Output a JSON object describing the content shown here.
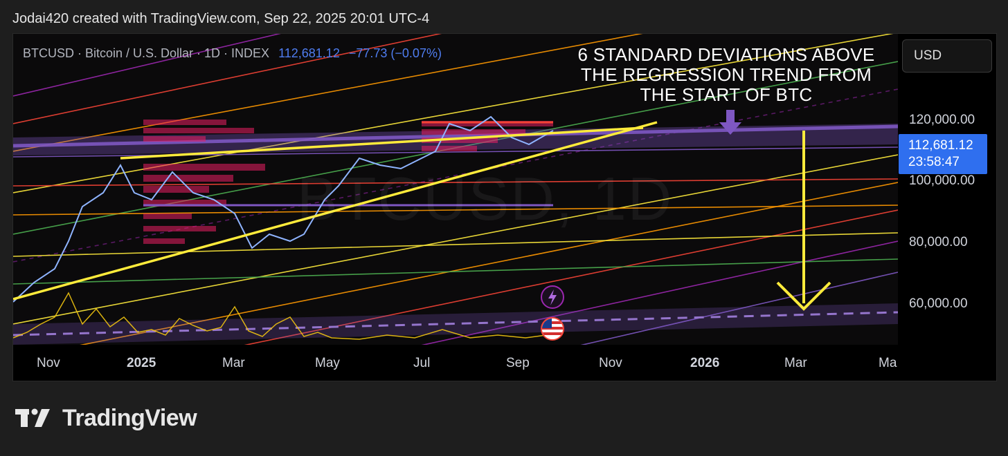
{
  "header": {
    "attribution": "Jodai420 created with TradingView.com, Sep 22, 2025 20:01 UTC-4"
  },
  "legend": {
    "symbol_text": "BTCUSD · Bitcoin / U.S. Dollar · 1D · INDEX",
    "price": "112,681.12",
    "change": "−77.73 (−0.07%)"
  },
  "annotation": {
    "lines": [
      "6 STANDARD DEVIATIONS ABOVE",
      "THE REGRESSION TREND FROM",
      "THE START OF BTC"
    ]
  },
  "watermark": "BTCUSD, 1D",
  "currency_button": "USD",
  "y_axis": {
    "ticks": [
      "120,000.00",
      "100,000.00",
      "80,000.00",
      "60,000.00"
    ]
  },
  "price_tag": {
    "price": "112,681.12",
    "countdown": "23:58:47"
  },
  "x_axis": {
    "ticks": [
      {
        "label": "Nov",
        "bold": false
      },
      {
        "label": "2025",
        "bold": true
      },
      {
        "label": "Mar",
        "bold": false
      },
      {
        "label": "May",
        "bold": false
      },
      {
        "label": "Jul",
        "bold": false
      },
      {
        "label": "Sep",
        "bold": false
      },
      {
        "label": "Nov",
        "bold": false
      },
      {
        "label": "2026",
        "bold": true
      },
      {
        "label": "Mar",
        "bold": false
      },
      {
        "label": "Ma",
        "bold": false
      }
    ]
  },
  "events": {
    "lightning_icon": "lightning-icon",
    "flag_icon": "us-flag-icon"
  },
  "brand": {
    "name": "TradingView"
  },
  "colors": {
    "accent_blue": "#2f6fef",
    "trend_yellow": "#ffeb3b",
    "band_purple": "#7e57c2"
  }
}
